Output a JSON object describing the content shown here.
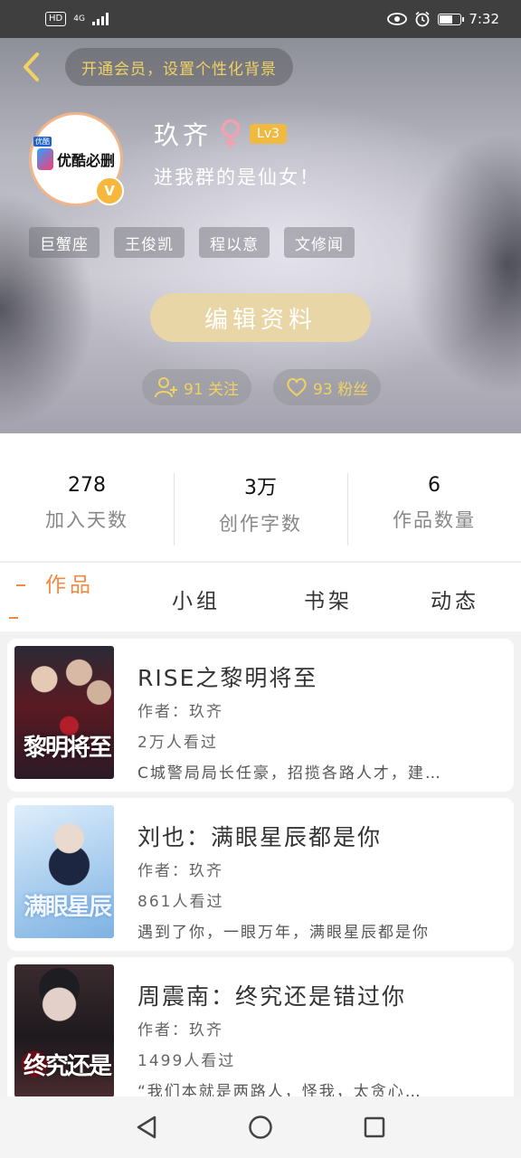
{
  "status_bar": {
    "hd": "HD",
    "network": "4G",
    "time": "7:32",
    "battery_level": 0.7
  },
  "header": {
    "member_prompt": "开通会员，设置个性化背景",
    "avatar_text": "优酷必删",
    "vip_badge": "V",
    "username": "玖齐",
    "level": "Lv3",
    "bio": "进我群的是仙女！",
    "tags": [
      "巨蟹座",
      "王俊凯",
      "程以意",
      "文修闻"
    ],
    "edit_button": "编辑资料",
    "following": "91 关注",
    "followers": "93 粉丝",
    "accent_color": "#f0d263"
  },
  "stats": [
    {
      "value": "278",
      "label": "加入天数"
    },
    {
      "value": "3万",
      "label": "创作字数"
    },
    {
      "value": "6",
      "label": "作品数量"
    }
  ],
  "tabs": [
    {
      "label": "作品",
      "active": true
    },
    {
      "label": "小组",
      "active": false
    },
    {
      "label": "书架",
      "active": false
    },
    {
      "label": "动态",
      "active": false
    }
  ],
  "works": [
    {
      "title": "RISE之黎明将至",
      "author": "作者：玖齐",
      "views": "2万人看过",
      "desc": "C城警局局长任豪，招揽各路人才，建…",
      "cover_text": "黎明将至"
    },
    {
      "title": "刘也：满眼星辰都是你",
      "author": "作者：玖齐",
      "views": "861人看过",
      "desc": "遇到了你，一眼万年，满眼星辰都是你",
      "cover_text": "满眼星辰"
    },
    {
      "title": "周震南：终究还是错过你",
      "author": "作者：玖齐",
      "views": "1499人看过",
      "desc": "“我们本就是两路人，怪我，太贪心…",
      "cover_text": "终究还是"
    }
  ],
  "colors": {
    "active_tab": "#f08a42",
    "edit_button_bg": "#e9d6a6",
    "level_badge": "#f0b940",
    "gender": "#f3a0b0"
  }
}
